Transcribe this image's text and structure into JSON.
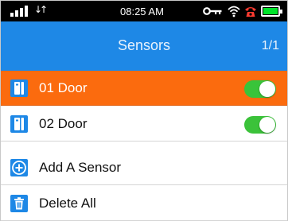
{
  "status_bar": {
    "time": "08:25 AM",
    "data_arrows": "↓↑",
    "battery_color": "#00e32a"
  },
  "header": {
    "title": "Sensors",
    "page_indicator": "1/1",
    "background": "#1e88e6"
  },
  "sensors": [
    {
      "label": "01 Door",
      "icon": "door-sensor-icon",
      "enabled": true,
      "selected": true
    },
    {
      "label": "02 Door",
      "icon": "door-sensor-icon",
      "enabled": true,
      "selected": false
    }
  ],
  "actions": {
    "add_label": "Add A Sensor",
    "add_icon": "plus-circle-icon",
    "delete_label": "Delete All",
    "delete_icon": "trash-icon"
  },
  "colors": {
    "selected_row": "#fb6b0e",
    "toggle_on": "#3bc23a",
    "icon_blue": "#1e88e6"
  }
}
